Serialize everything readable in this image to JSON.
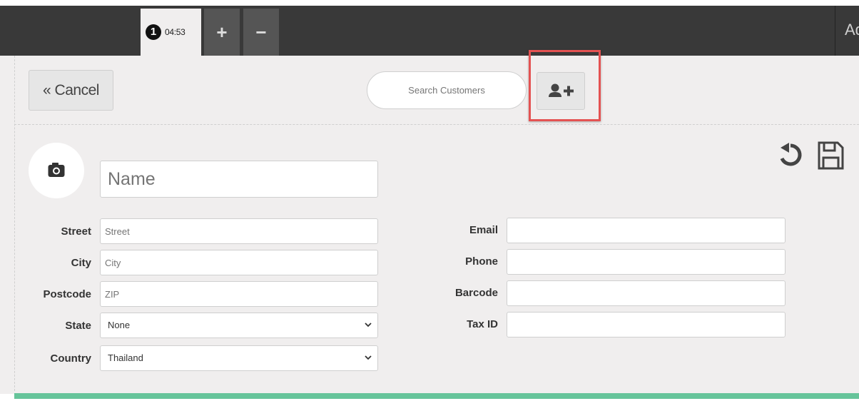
{
  "topbar": {
    "order_number": "1",
    "order_time": "04:53",
    "add_tab_label": "+",
    "remove_tab_label": "−",
    "right_truncated_text": "Ad"
  },
  "toolbar": {
    "cancel_label": "« Cancel",
    "search_placeholder": "Search Customers",
    "add_customer_icon": "user-plus-icon"
  },
  "form": {
    "photo_icon": "camera-icon",
    "name_placeholder": "Name",
    "fields_left": [
      {
        "label": "Street",
        "placeholder": "Street"
      },
      {
        "label": "City",
        "placeholder": "City"
      },
      {
        "label": "Postcode",
        "placeholder": "ZIP"
      },
      {
        "label": "State",
        "value": "None"
      },
      {
        "label": "Country",
        "value": "Thailand"
      }
    ],
    "fields_right": [
      {
        "label": "Email",
        "value": ""
      },
      {
        "label": "Phone",
        "value": ""
      },
      {
        "label": "Barcode",
        "value": ""
      },
      {
        "label": "Tax ID",
        "value": ""
      }
    ],
    "reset_icon": "undo-icon",
    "save_icon": "floppy-disk-icon"
  },
  "colors": {
    "topbar": "#393939",
    "panel": "#f0eeee",
    "highlight": "#e45252",
    "accent_bar": "#66c49a"
  }
}
